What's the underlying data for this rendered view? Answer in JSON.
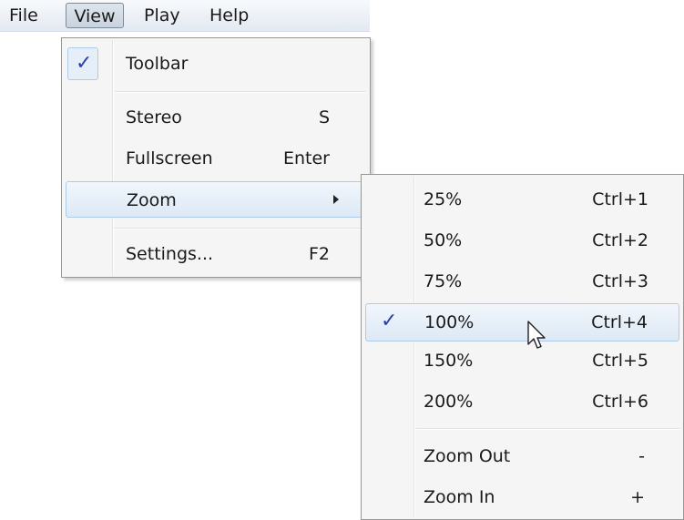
{
  "menubar": {
    "file": "File",
    "view": "View",
    "play": "Play",
    "help": "Help"
  },
  "view_menu": {
    "toolbar": {
      "label": "Toolbar",
      "checked": true,
      "check_icon": "✓"
    },
    "stereo": {
      "label": "Stereo",
      "shortcut": "S"
    },
    "fullscreen": {
      "label": "Fullscreen",
      "shortcut": "Enter"
    },
    "zoom": {
      "label": "Zoom",
      "submenu_icon": "submenu-arrow-icon"
    },
    "settings": {
      "label": "Settings...",
      "shortcut": "F2"
    }
  },
  "zoom_menu": {
    "items": [
      {
        "label": "25%",
        "shortcut": "Ctrl+1"
      },
      {
        "label": "50%",
        "shortcut": "Ctrl+2"
      },
      {
        "label": "75%",
        "shortcut": "Ctrl+3"
      },
      {
        "label": "100%",
        "shortcut": "Ctrl+4",
        "checked": true
      },
      {
        "label": "150%",
        "shortcut": "Ctrl+5"
      },
      {
        "label": "200%",
        "shortcut": "Ctrl+6"
      }
    ],
    "zoom_out": {
      "label": "Zoom Out",
      "shortcut": "-"
    },
    "zoom_in": {
      "label": "Zoom In",
      "shortcut": "+"
    },
    "check_icon": "✓"
  },
  "colors": {
    "check": "#2a3fa8",
    "highlight_border": "#aecbe8",
    "menu_bg": "#f5f5f5"
  }
}
